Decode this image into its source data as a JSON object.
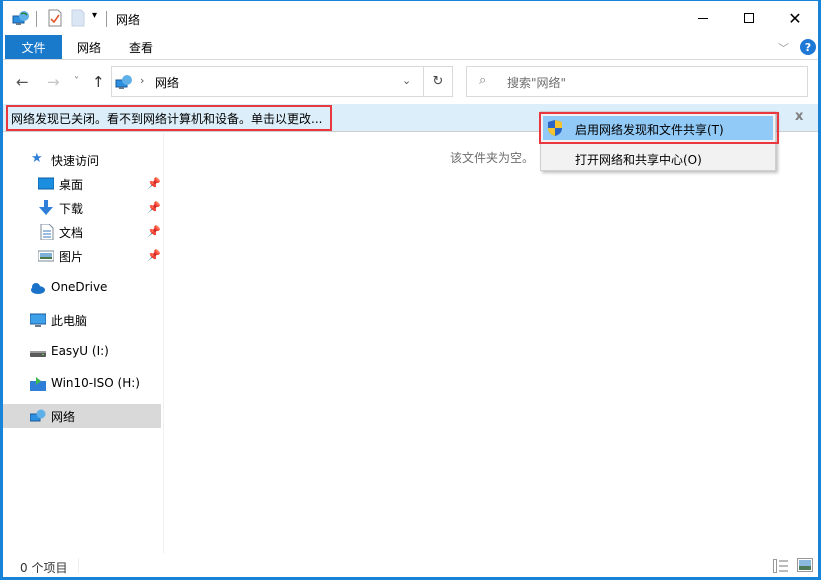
{
  "window": {
    "title": "网络",
    "controls": {
      "minimize": "minimize",
      "maximize": "maximize",
      "close": "close"
    }
  },
  "quick_access_toolbar": {
    "icons": [
      "network-icon",
      "properties-icon",
      "new-folder-icon",
      "customize-dropdown-icon"
    ]
  },
  "ribbon": {
    "tabs": [
      {
        "label": "文件",
        "active": true
      },
      {
        "label": "网络",
        "active": false
      },
      {
        "label": "查看",
        "active": false
      }
    ],
    "help": "?"
  },
  "navigation": {
    "back": "←",
    "forward": "→",
    "recent": "˅",
    "up": "↑",
    "address": {
      "separator": "›",
      "location": "网络"
    },
    "refresh": "↻",
    "search": {
      "placeholder": "搜索\"网络\""
    }
  },
  "infobar": {
    "message": "网络发现已关闭。看不到网络计算机和设备。单击以更改...",
    "close": "x"
  },
  "context_menu": {
    "items": [
      {
        "label": "启用网络发现和文件共享(T)",
        "icon": "uac-shield-icon",
        "highlighted": true
      },
      {
        "label": "打开网络和共享中心(O)",
        "icon": "",
        "highlighted": false
      }
    ]
  },
  "sidebar": {
    "quick_access": {
      "label": "快速访问"
    },
    "pinned": [
      {
        "label": "桌面",
        "icon": "desktop-icon"
      },
      {
        "label": "下载",
        "icon": "download-icon"
      },
      {
        "label": "文档",
        "icon": "documents-icon"
      },
      {
        "label": "图片",
        "icon": "pictures-icon"
      }
    ],
    "locations": [
      {
        "label": "OneDrive",
        "icon": "onedrive-icon"
      },
      {
        "label": "此电脑",
        "icon": "this-pc-icon"
      },
      {
        "label": "EasyU (I:)",
        "icon": "drive-icon"
      },
      {
        "label": "Win10-ISO (H:)",
        "icon": "iso-drive-icon"
      },
      {
        "label": "网络",
        "icon": "network-icon",
        "selected": true
      }
    ]
  },
  "content": {
    "empty_message": "该文件夹为空。"
  },
  "status_bar": {
    "item_count": "0 个项目",
    "views": [
      "details-view",
      "large-icons-view"
    ]
  },
  "colors": {
    "accent": "#1979ca",
    "highlight_border": "#e8373f",
    "infobar_bg": "#dbeefa",
    "menu_highlight": "#91c9f7"
  }
}
